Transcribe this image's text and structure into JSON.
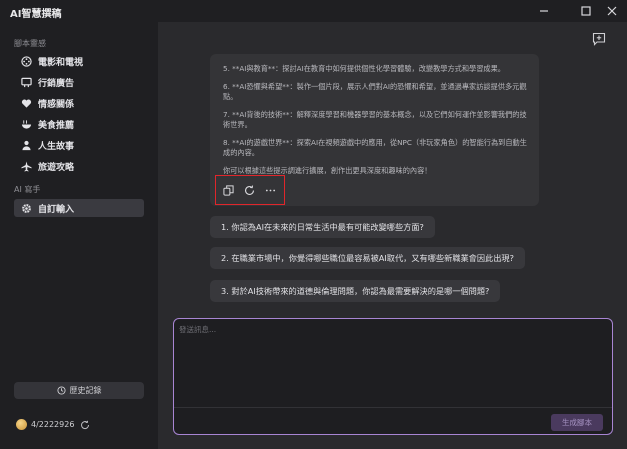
{
  "app": {
    "title": "AI智慧撰稿"
  },
  "sidebar": {
    "section1_title": "腳本靈感",
    "items": [
      {
        "label": "電影和電視",
        "icon": "film-reel-icon"
      },
      {
        "label": "行銷廣告",
        "icon": "billboard-icon"
      },
      {
        "label": "情感關係",
        "icon": "heart-icon"
      },
      {
        "label": "美食推薦",
        "icon": "food-bowl-icon"
      },
      {
        "label": "人生故事",
        "icon": "person-icon"
      },
      {
        "label": "旅遊攻略",
        "icon": "airplane-icon"
      }
    ],
    "section2_title": "AI 寫手",
    "active_item": {
      "label": "自訂輸入",
      "icon": "gear-icon"
    },
    "history_label": "歷史記錄",
    "credits": "4/2222926"
  },
  "chat": {
    "lines": [
      "5. **AI與教育**：探討AI在教育中如何提供個性化學習體驗，改變教學方式和學習成果。",
      "6. **AI恐懼與希望**：製作一個片段，展示人們對AI的恐懼和希望，並通過專家訪談提供多元觀點。",
      "7. **AI背後的技術**：解釋深度學習和機器學習的基本概念，以及它們如何運作並影響我們的技術世界。",
      "8. **AI的遊戲世界**：探索AI在視頻遊戲中的應用，從NPC（非玩家角色）的智能行為到自動生成的內容。",
      "你可以根據這些提示調進行擴展，創作出更具深度和趣味的內容！"
    ],
    "actions": [
      "copy-icon",
      "regenerate-icon",
      "more-icon"
    ],
    "suggestions": [
      "1. 你認為AI在未來的日常生活中最有可能改變哪些方面?",
      "2. 在職業市場中，你覺得哪些職位最容易被AI取代，又有哪些新職業會因此出現?",
      "3. 對於AI技術帶來的道德與倫理問題，你認為最需要解決的是哪一個問題?"
    ]
  },
  "input": {
    "placeholder": "發送訊息...",
    "value": "",
    "generate_label": "生成腳本"
  },
  "colors": {
    "accent": "#a885d3",
    "highlight_border": "#e0262b",
    "background": "#2a2a2d"
  }
}
